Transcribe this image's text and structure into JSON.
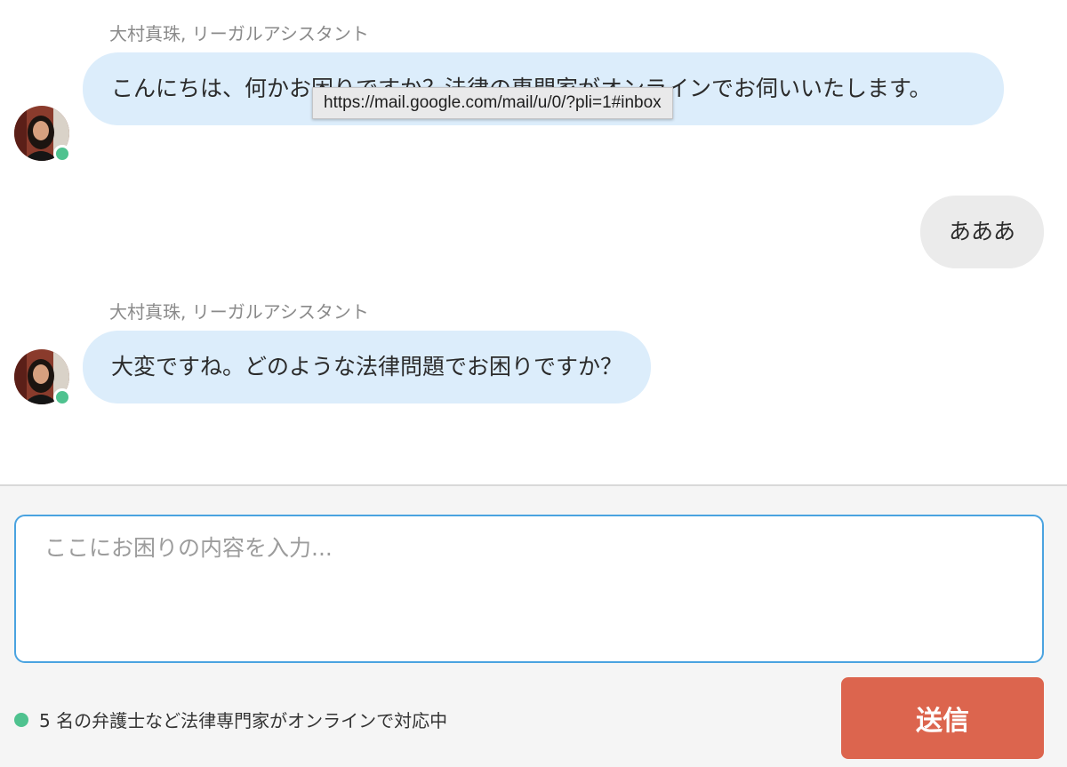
{
  "messages": [
    {
      "sender": "大村真珠, リーガルアシスタント",
      "text": "こんにちは、何かお困りですか？法律の専門家がオンラインでお伺いいたします。",
      "online": true
    },
    {
      "text": "あああ"
    },
    {
      "sender": "大村真珠, リーガルアシスタント",
      "text": "大変ですね。どのような法律問題でお困りですか？",
      "online": true
    }
  ],
  "tooltip": "https://mail.google.com/mail/u/0/?pli=1#inbox",
  "composer": {
    "placeholder": "ここにお困りの内容を入力...",
    "value": "",
    "online_status": "5 名の弁護士など法律専門家がオンラインで対応中",
    "send_label": "送信"
  },
  "colors": {
    "incoming_bubble": "#dcedfb",
    "outgoing_bubble": "#ebebeb",
    "online": "#4fc28f",
    "send_button": "#dc654e",
    "input_border": "#4aa3e0"
  }
}
